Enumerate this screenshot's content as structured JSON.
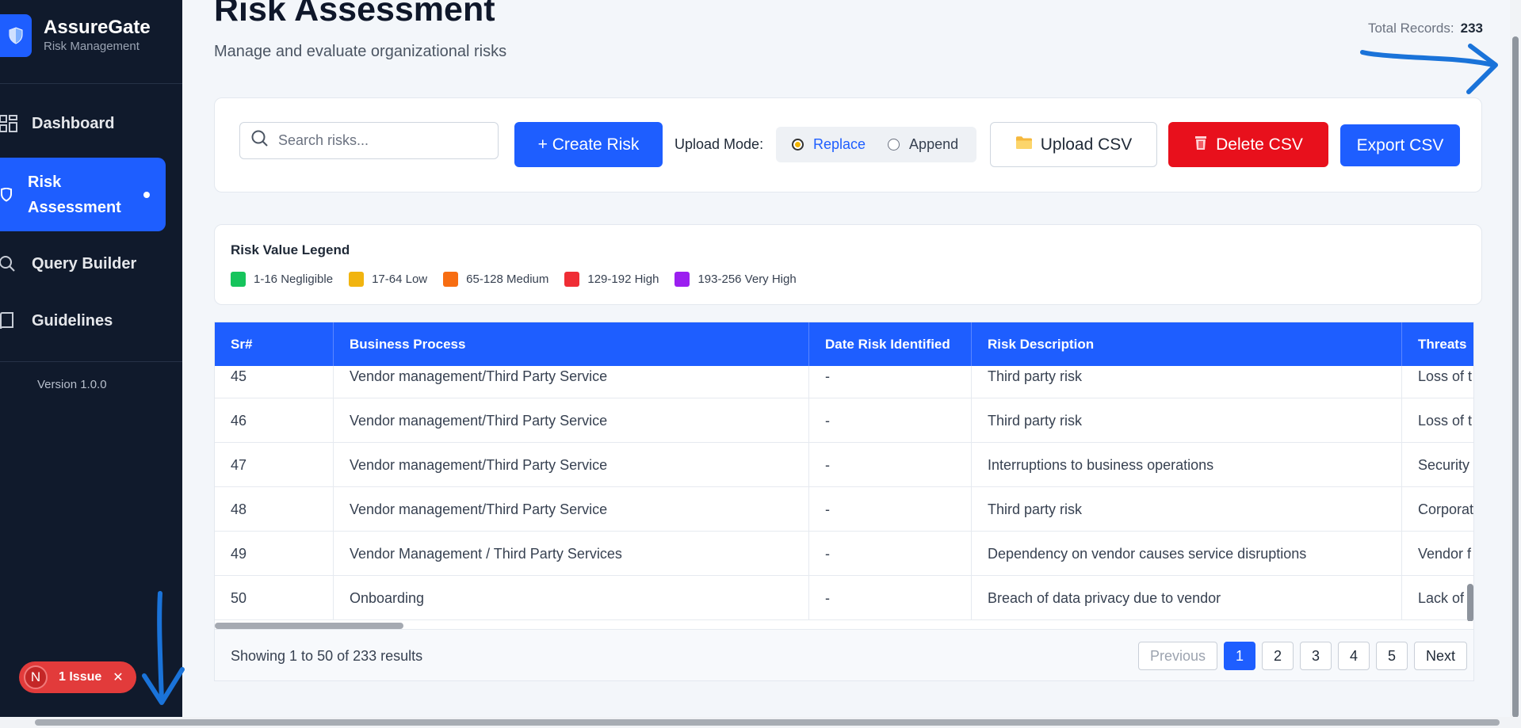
{
  "sidebar": {
    "brand_name": "AssureGate",
    "brand_sub": "Risk Management",
    "nav": [
      {
        "label": "Dashboard",
        "icon": "grid-icon"
      },
      {
        "label": "Risk Assessment",
        "icon": "shield-icon",
        "active": true
      },
      {
        "label": "Query Builder",
        "icon": "search-icon"
      },
      {
        "label": "Guidelines",
        "icon": "book-icon"
      }
    ],
    "version": "Version 1.0.0",
    "issue": {
      "avatar": "N",
      "label": "1 Issue"
    }
  },
  "header": {
    "title": "Risk Assessment",
    "subtitle": "Manage and evaluate organizational risks",
    "total_label": "Total Records:",
    "total_value": "233"
  },
  "toolbar": {
    "search_placeholder": "Search risks...",
    "search_value": "",
    "create_label": "+ Create Risk",
    "upload_mode_label": "Upload Mode:",
    "mode_replace": "Replace",
    "mode_append": "Append",
    "selected_mode": "Replace",
    "upload_label": "Upload CSV",
    "upload_icon": "📁",
    "delete_label": "Delete CSV",
    "delete_icon": "🗑",
    "export_label": "Export CSV"
  },
  "legend": {
    "title": "Risk Value Legend",
    "items": [
      {
        "label": "1-16 Negligible",
        "color": "#16c45c"
      },
      {
        "label": "17-64 Low",
        "color": "#f1b40f"
      },
      {
        "label": "65-128 Medium",
        "color": "#f76d12"
      },
      {
        "label": "129-192 High",
        "color": "#ef2d35"
      },
      {
        "label": "193-256 Very High",
        "color": "#9b1ff0"
      }
    ]
  },
  "table": {
    "columns": [
      "Sr#",
      "Business Process",
      "Date Risk Identified",
      "Risk Description",
      "Threats"
    ],
    "rows": [
      [
        "45",
        "Vendor management/Third Party Service",
        "-",
        "Third party risk",
        "Loss of t"
      ],
      [
        "46",
        "Vendor management/Third Party Service",
        "-",
        "Third party risk",
        "Loss of t"
      ],
      [
        "47",
        "Vendor management/Third Party Service",
        "-",
        "Interruptions to business operations",
        "Security"
      ],
      [
        "48",
        "Vendor management/Third Party Service",
        "-",
        "Third party risk",
        "Corporat"
      ],
      [
        "49",
        "Vendor Management / Third Party Services",
        "-",
        "Dependency on vendor causes service disruptions",
        "Vendor f"
      ],
      [
        "50",
        "Onboarding",
        "-",
        "Breach of data privacy due to vendor",
        "Lack of v"
      ]
    ],
    "showing": "Showing 1 to 50 of 233 results"
  },
  "pagination": {
    "previous": "Previous",
    "pages": [
      "1",
      "2",
      "3",
      "4",
      "5"
    ],
    "current": "1",
    "next": "Next"
  },
  "colors": {
    "accent": "#1e5eff",
    "sidebar_bg": "#101a2c",
    "danger": "#e8101c",
    "annotation": "#1a73d9"
  }
}
